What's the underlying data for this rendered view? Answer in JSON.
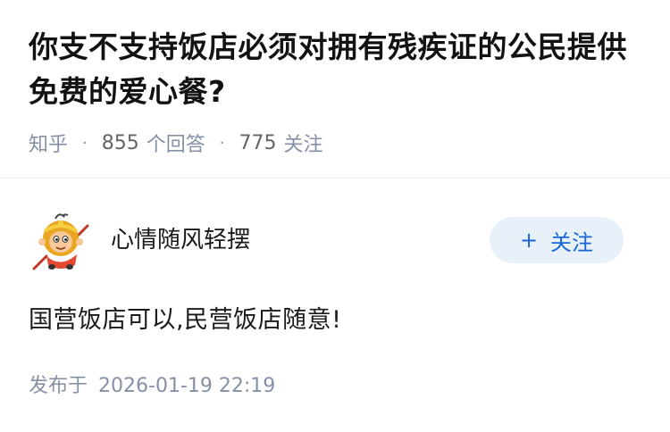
{
  "question": {
    "title": "你支不支持饭店必须对拥有残疾证的公民提供免费的爱心餐?",
    "source": "知乎",
    "answer_count": "855",
    "answer_label": "个回答",
    "follower_count": "775",
    "follower_label": "关注"
  },
  "answer": {
    "author": {
      "name": "心情随风轻摆",
      "avatar_icon": "monkey-king-avatar-icon"
    },
    "follow_button": {
      "icon": "plus-icon",
      "label": "关注",
      "plus": "+"
    },
    "content": "国营饭店可以,民营饭店随意!",
    "publish": {
      "label": "发布于",
      "time": "2026-01-19 22:19"
    }
  },
  "colors": {
    "accent": "#1766d6",
    "follow_bg": "#e8f0fa",
    "meta_text": "#8590a6"
  }
}
